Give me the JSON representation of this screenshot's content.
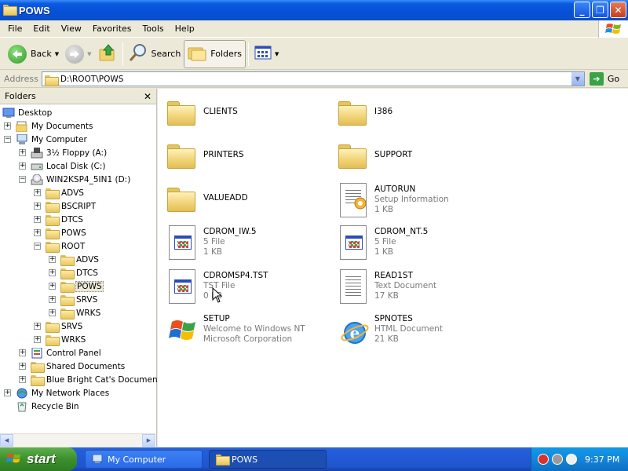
{
  "window": {
    "title": "POWS"
  },
  "menu": [
    "File",
    "Edit",
    "View",
    "Favorites",
    "Tools",
    "Help"
  ],
  "toolbar": {
    "back_label": "Back",
    "search_label": "Search",
    "folders_label": "Folders"
  },
  "address": {
    "label": "Address",
    "value": "D:\\ROOT\\POWS",
    "go_label": "Go"
  },
  "folders_pane": {
    "title": "Folders",
    "tree": [
      {
        "label": "Desktop",
        "depth": 0,
        "expander": "none",
        "icon": "desktop-icon"
      },
      {
        "label": "My Documents",
        "depth": 1,
        "expander": "+",
        "icon": "my-documents-icon"
      },
      {
        "label": "My Computer",
        "depth": 1,
        "expander": "-",
        "icon": "my-computer-icon"
      },
      {
        "label": "3½ Floppy (A:)",
        "depth": 2,
        "expander": "+",
        "icon": "floppy-drive-icon"
      },
      {
        "label": "Local Disk (C:)",
        "depth": 2,
        "expander": "+",
        "icon": "hard-disk-icon"
      },
      {
        "label": "WIN2KSP4_5IN1 (D:)",
        "depth": 2,
        "expander": "-",
        "icon": "cd-drive-icon"
      },
      {
        "label": "ADVS",
        "depth": 3,
        "expander": "+",
        "icon": "folder-icon"
      },
      {
        "label": "BSCRIPT",
        "depth": 3,
        "expander": "+",
        "icon": "folder-icon"
      },
      {
        "label": "DTCS",
        "depth": 3,
        "expander": "+",
        "icon": "folder-icon"
      },
      {
        "label": "POWS",
        "depth": 3,
        "expander": "+",
        "icon": "folder-icon"
      },
      {
        "label": "ROOT",
        "depth": 3,
        "expander": "-",
        "icon": "folder-icon"
      },
      {
        "label": "ADVS",
        "depth": 4,
        "expander": "+",
        "icon": "folder-icon"
      },
      {
        "label": "DTCS",
        "depth": 4,
        "expander": "+",
        "icon": "folder-icon"
      },
      {
        "label": "POWS",
        "depth": 4,
        "expander": "+",
        "icon": "folder-icon",
        "selected": true
      },
      {
        "label": "SRVS",
        "depth": 4,
        "expander": "+",
        "icon": "folder-icon"
      },
      {
        "label": "WRKS",
        "depth": 4,
        "expander": "+",
        "icon": "folder-icon"
      },
      {
        "label": "SRVS",
        "depth": 3,
        "expander": "+",
        "icon": "folder-icon"
      },
      {
        "label": "WRKS",
        "depth": 3,
        "expander": "+",
        "icon": "folder-icon"
      },
      {
        "label": "Control Panel",
        "depth": 2,
        "expander": "+",
        "icon": "control-panel-icon"
      },
      {
        "label": "Shared Documents",
        "depth": 2,
        "expander": "+",
        "icon": "folder-icon"
      },
      {
        "label": "Blue Bright Cat's Documents",
        "depth": 2,
        "expander": "+",
        "icon": "folder-icon"
      },
      {
        "label": "My Network Places",
        "depth": 1,
        "expander": "+",
        "icon": "network-places-icon"
      },
      {
        "label": "Recycle Bin",
        "depth": 1,
        "expander": "none",
        "icon": "recycle-bin-icon"
      }
    ]
  },
  "files": [
    {
      "name": "CLIENTS",
      "line2": "",
      "line3": "",
      "icon": "folder-icon"
    },
    {
      "name": "I386",
      "line2": "",
      "line3": "",
      "icon": "folder-icon"
    },
    {
      "name": "PRINTERS",
      "line2": "",
      "line3": "",
      "icon": "folder-icon"
    },
    {
      "name": "SUPPORT",
      "line2": "",
      "line3": "",
      "icon": "folder-icon"
    },
    {
      "name": "VALUEADD",
      "line2": "",
      "line3": "",
      "icon": "folder-icon"
    },
    {
      "name": "AUTORUN",
      "line2": "Setup Information",
      "line3": "1 KB",
      "icon": "setup-info-icon"
    },
    {
      "name": "CDROM_IW.5",
      "line2": "5 File",
      "line3": "1 KB",
      "icon": "generic-file-icon"
    },
    {
      "name": "CDROM_NT.5",
      "line2": "5 File",
      "line3": "1 KB",
      "icon": "generic-file-icon"
    },
    {
      "name": "CDROMSP4.TST",
      "line2": "TST File",
      "line3": "0 KB",
      "icon": "generic-file-icon"
    },
    {
      "name": "READ1ST",
      "line2": "Text Document",
      "line3": "17 KB",
      "icon": "text-document-icon"
    },
    {
      "name": "SETUP",
      "line2": "Welcome to Windows NT",
      "line3": "Microsoft Corporation",
      "icon": "windows-setup-icon"
    },
    {
      "name": "SPNOTES",
      "line2": "HTML Document",
      "line3": "21 KB",
      "icon": "internet-explorer-icon"
    }
  ],
  "taskbar": {
    "start_label": "start",
    "tasks": [
      {
        "label": "My Computer",
        "active": false
      },
      {
        "label": "POWS",
        "active": true
      }
    ],
    "clock": "9:37 PM"
  },
  "colors": {
    "titlebar": "#0A5BE0",
    "taskbar": "#245EDC",
    "start": "#3C8F2D",
    "tray": "#1585D8"
  }
}
